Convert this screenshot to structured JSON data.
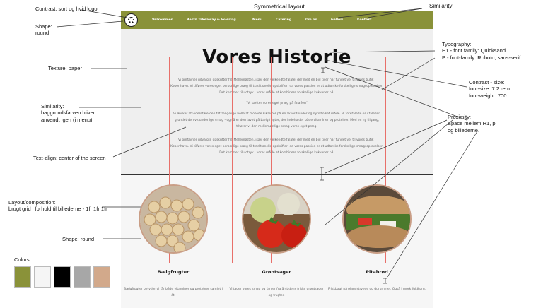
{
  "annotations": {
    "contrast_logo": "Contrast: sort og hvid logo.",
    "symmetrical": "Symmetrical layout",
    "similarity_top": "Similarity",
    "shape_round_logo": [
      "Shape:",
      "round"
    ],
    "texture": "Texture: paper",
    "similarity_bg": [
      "Similarity:",
      "baggrundsfarven bliver",
      "anvendt igen (i menu)"
    ],
    "text_align": "Text-align: center of the screen",
    "layout": [
      "Layout/composition:",
      "brugt grid i forhold til billederne - 1fr 1fr 1fr"
    ],
    "shape_round_img": "Shape: round",
    "colors_label": "Colors:",
    "typography": [
      "Typography:",
      "H1 - font family: Quicksand",
      "P - font-family: Roboto, sans-serif"
    ],
    "contrast_size": [
      "Contrast - size:",
      "font-size: 7.2 rem",
      "font-weight: 700"
    ],
    "proximity": [
      "Proximity:",
      "Space mellem H1, p",
      "og billederne."
    ]
  },
  "nav": {
    "items": [
      "Velkommen",
      "Bestil Takeaway & levering",
      "Menu",
      "Catering",
      "Om os",
      "Galleri",
      "Kontakt"
    ]
  },
  "hero": {
    "title": "Vores Historie",
    "p1": "Vi omfavner udvalgte opskrifter fra Mellemøsten, især den velkendte falafel der med en bid tiser har fundet vej til vores butik i København. Vi tilfører vores eget personlige præg til traditionelle opskrifter, da vores passion er at udforske forskellige smagsoplevelser. Det kommer til udtryk i vores måde at kombinere forskellige køkkener på.",
    "quote": "\"Vi sætter vores eget præg på falaflen\"",
    "p2": "Vi ønsker at videreføre den tiltrængelige bolle af mosede kikærter på en akkordhinder og nyfortolket måde. Vi foretalede os i falaflen grundet den vidunderlige smag - og så er den lavet på bælgfrugter, der indeholder både vitaminer og proteiner. Med en ny tilgang, tilfører vi den mellemøstlige smag vores eget præg.",
    "p3": "Vi omfavner udvalgte opskrifter fra Mellemøsten, især den velkendte falafel der med en bid tiser har fundet vej til vores butik i København. Vi tilfører vores eget personlige præg til traditionelle opskrifter, da vores passion er at udforske forskellige smagsoplevelser. Det kommer til udtryk i vores måde at kombinere forskellige køkkener på."
  },
  "cards": [
    {
      "title": "Bælgfrugter",
      "text": "Bælgfrugter betyder vi får både vitaminer og proteiner samlet i ét."
    },
    {
      "title": "Grøntsager",
      "text": "Vi tager vores smag og farver fra årstidens friske grøntsager og frugter."
    },
    {
      "title": "Pitabrød",
      "text": "Friskbagt på ølandstrvede og durummel. Også i mørk fuldkorn."
    }
  ],
  "colors": {
    "palette": [
      "#8a9239",
      "#f5f5f5",
      "#000000",
      "#a7a7a7",
      "#d2a98b"
    ],
    "nav_bg": "#8a9239",
    "guide_line": "#e8706a"
  }
}
